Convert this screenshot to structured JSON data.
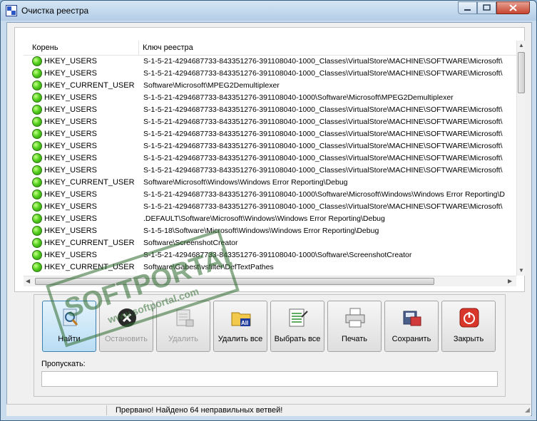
{
  "window": {
    "title": "Очистка реестра"
  },
  "list": {
    "col_root": "Корень",
    "col_key": "Ключ реестра",
    "rows": [
      {
        "root": "HKEY_USERS",
        "key": "S-1-5-21-4294687733-843351276-391108040-1000_Classes\\VirtualStore\\MACHINE\\SOFTWARE\\Microsoft\\"
      },
      {
        "root": "HKEY_USERS",
        "key": "S-1-5-21-4294687733-843351276-391108040-1000_Classes\\VirtualStore\\MACHINE\\SOFTWARE\\Microsoft\\"
      },
      {
        "root": "HKEY_CURRENT_USER",
        "key": "Software\\Microsoft\\MPEG2Demultiplexer"
      },
      {
        "root": "HKEY_USERS",
        "key": "S-1-5-21-4294687733-843351276-391108040-1000\\Software\\Microsoft\\MPEG2Demultiplexer"
      },
      {
        "root": "HKEY_USERS",
        "key": "S-1-5-21-4294687733-843351276-391108040-1000_Classes\\VirtualStore\\MACHINE\\SOFTWARE\\Microsoft\\"
      },
      {
        "root": "HKEY_USERS",
        "key": "S-1-5-21-4294687733-843351276-391108040-1000_Classes\\VirtualStore\\MACHINE\\SOFTWARE\\Microsoft\\"
      },
      {
        "root": "HKEY_USERS",
        "key": "S-1-5-21-4294687733-843351276-391108040-1000_Classes\\VirtualStore\\MACHINE\\SOFTWARE\\Microsoft\\"
      },
      {
        "root": "HKEY_USERS",
        "key": "S-1-5-21-4294687733-843351276-391108040-1000_Classes\\VirtualStore\\MACHINE\\SOFTWARE\\Microsoft\\"
      },
      {
        "root": "HKEY_USERS",
        "key": "S-1-5-21-4294687733-843351276-391108040-1000_Classes\\VirtualStore\\MACHINE\\SOFTWARE\\Microsoft\\"
      },
      {
        "root": "HKEY_USERS",
        "key": "S-1-5-21-4294687733-843351276-391108040-1000_Classes\\VirtualStore\\MACHINE\\SOFTWARE\\Microsoft\\"
      },
      {
        "root": "HKEY_CURRENT_USER",
        "key": "Software\\Microsoft\\Windows\\Windows Error Reporting\\Debug"
      },
      {
        "root": "HKEY_USERS",
        "key": "S-1-5-21-4294687733-843351276-391108040-1000\\Software\\Microsoft\\Windows\\Windows Error Reporting\\D"
      },
      {
        "root": "HKEY_USERS",
        "key": "S-1-5-21-4294687733-843351276-391108040-1000_Classes\\VirtualStore\\MACHINE\\SOFTWARE\\Microsoft\\"
      },
      {
        "root": "HKEY_USERS",
        "key": ".DEFAULT\\Software\\Microsoft\\Windows\\Windows Error Reporting\\Debug"
      },
      {
        "root": "HKEY_USERS",
        "key": "S-1-5-18\\Software\\Microsoft\\Windows\\Windows Error Reporting\\Debug"
      },
      {
        "root": "HKEY_CURRENT_USER",
        "key": "Software\\ScreenshotCreator"
      },
      {
        "root": "HKEY_USERS",
        "key": "S-1-5-21-4294687733-843351276-391108040-1000\\Software\\ScreenshotCreator"
      },
      {
        "root": "HKEY_CURRENT_USER",
        "key": "Software\\Gabest\\vsfilter\\DefTextPathes"
      }
    ]
  },
  "buttons": {
    "find": "Найти",
    "stop": "Остановить",
    "delete": "Удалить",
    "delete_all": "Удалить все",
    "select_all": "Выбрать все",
    "print": "Печать",
    "save": "Сохранить",
    "close": "Закрыть"
  },
  "skip": {
    "label": "Пропускать:",
    "value": ""
  },
  "status": {
    "text": "Прервано! Найдено 64 неправильных ветвей!"
  },
  "watermark": {
    "brand": "SOFTPORTAL",
    "url": "www.softportal.com"
  }
}
